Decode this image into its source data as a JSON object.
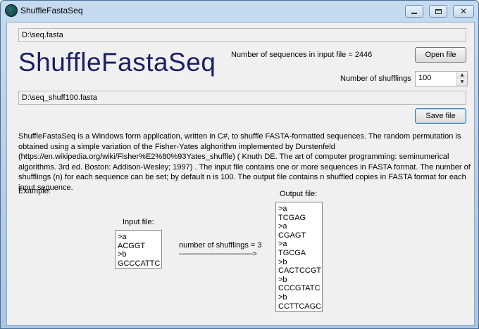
{
  "window": {
    "title": "ShuffleFastaSeq"
  },
  "input_path": "D:\\seq.fasta",
  "app_heading": "ShuffleFastaSeq",
  "sequence_count_text": "Number of sequences in input file = 2446",
  "open_file_label": "Open file",
  "shufflings": {
    "label": "Number of shufflings",
    "value": "100",
    "up_arrow": "▲",
    "down_arrow": "▼"
  },
  "output_path": "D:\\seq_shuff100.fasta",
  "save_file_label": "Save file",
  "description": "ShuffleFastaSeq is a Windows form application, written in C#, to shuffle FASTA-formatted sequences.  The random permutation is obtained using a simple variation of the Fisher-Yates alghorithm implemented by Durstenfeld (https://en.wikipedia.org/wiki/Fisher%E2%80%93Yates_shuffle) ( Knuth DE. The art of computer programming: seminumerical algorithms. 3rd ed. Boston: Addison-Wesley; 1997) . The input file contains one or more sequences in FASTA format. The number of shufflings (n) for each sequence can be set; by default n is 100. The output file contains n shuffled copies in FASTA format for each input sequence.",
  "example": {
    "label": "Example:",
    "input_label": "Input file:",
    "input_lines": [
      ">a",
      "ACGGT",
      ">b",
      "GCCCATTC"
    ],
    "arrow_label": "number of shufflings = 3",
    "arrow_line": "------------------------------------->",
    "output_label": "Output file:",
    "output_lines": [
      ">a",
      "TCGAG",
      ">a",
      "CGAGT",
      ">a",
      "TGCGA",
      ">b",
      "CACTCCGT",
      ">b",
      "CCCGTATC",
      ">b",
      "CCTTCAGC"
    ]
  },
  "icons": {
    "app": "app-logo-icon",
    "close_glyph": "✕"
  }
}
